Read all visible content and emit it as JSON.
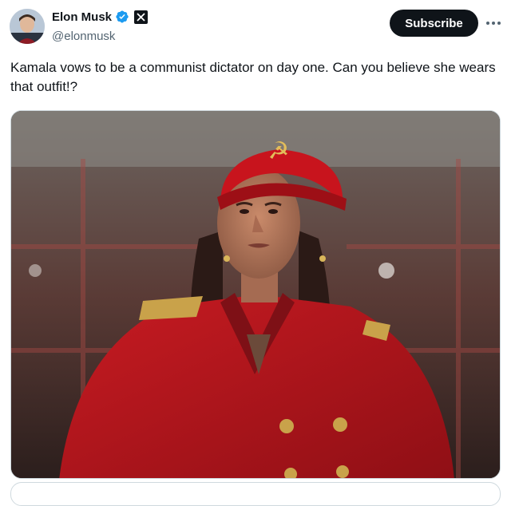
{
  "tweet": {
    "author": {
      "display_name": "Elon Musk",
      "handle": "@elonmusk",
      "verified": true,
      "affiliate_badge_icon": "x-logo-icon",
      "avatar_icon": "avatar"
    },
    "subscribe_label": "Subscribe",
    "more_icon": "more-icon",
    "text": "Kamala vows to be a communist dictator on day one. Can you believe she wears that outfit!?",
    "media": {
      "type": "image",
      "hat_emblem": "☭"
    }
  },
  "colors": {
    "text_primary": "#0f1419",
    "text_secondary": "#536471",
    "verified_blue": "#1d9bf0",
    "subscribe_bg": "#0f1419",
    "border": "#cfd9de",
    "outfit_red": "#b3161b"
  }
}
